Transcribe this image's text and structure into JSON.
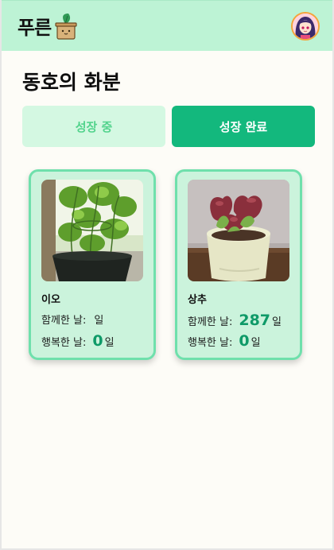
{
  "header": {
    "logo_text": "푸른",
    "logo_icon": "plant-pot-icon",
    "avatar_icon": "user-avatar"
  },
  "page": {
    "title": "동호의 화분"
  },
  "tabs": [
    {
      "label": "성장 중",
      "active": false
    },
    {
      "label": "성장 완료",
      "active": true
    }
  ],
  "plants": [
    {
      "name": "이오",
      "days_label": "함께한 날:",
      "days_value": "",
      "days_unit": "일",
      "happy_label": "행복한 날:",
      "happy_value": "0",
      "happy_unit": "일"
    },
    {
      "name": "상추",
      "days_label": "함께한 날:",
      "days_value": "287",
      "days_unit": "일",
      "happy_label": "행복한 날:",
      "happy_value": "0",
      "happy_unit": "일"
    }
  ],
  "colors": {
    "header_bg": "#bdf3d5",
    "accent": "#13b87d",
    "tab_inactive_bg": "#d4f8e2",
    "card_bg": "#cbf3dc",
    "card_border": "#6fe0ac"
  }
}
